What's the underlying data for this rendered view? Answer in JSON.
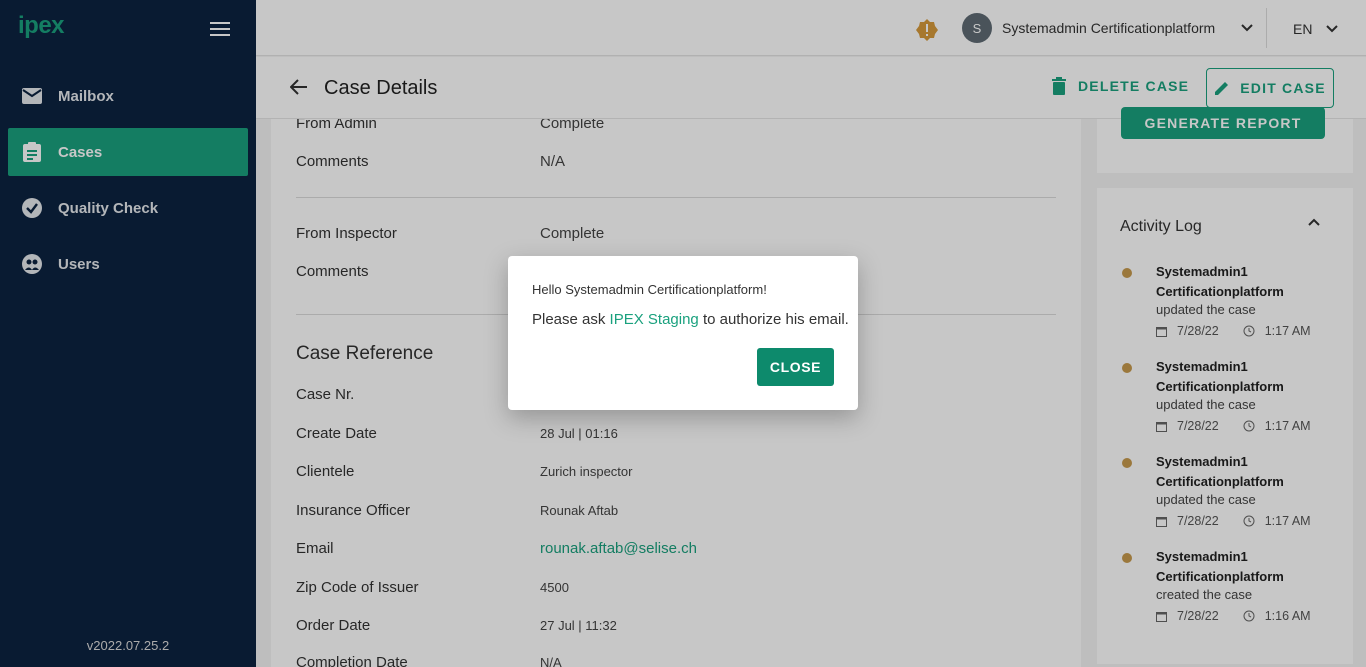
{
  "app": {
    "logo": "ipex",
    "version": "v2022.07.25.2"
  },
  "sidebar": {
    "items": [
      {
        "label": "Mailbox"
      },
      {
        "label": "Cases"
      },
      {
        "label": "Quality Check"
      },
      {
        "label": "Users"
      }
    ]
  },
  "topbar": {
    "avatar_initial": "S",
    "username": "Systemadmin Certificationplatform",
    "language": "EN"
  },
  "header": {
    "title": "Case Details",
    "delete_label": "DELETE CASE",
    "edit_label": "EDIT CASE"
  },
  "details": {
    "admin": {
      "label": "From Admin",
      "value": "Complete",
      "comments_label": "Comments",
      "comments_value": "N/A"
    },
    "inspector": {
      "label": "From Inspector",
      "value": "Complete",
      "comments_label": "Comments"
    },
    "case_reference": {
      "title": "Case Reference",
      "fields": [
        {
          "label": "Case Nr.",
          "value": ""
        },
        {
          "label": "Create Date",
          "value": "28 Jul | 01:16"
        },
        {
          "label": "Clientele",
          "value": "Zurich inspector"
        },
        {
          "label": "Insurance Officer",
          "value": "Rounak Aftab"
        },
        {
          "label": "Email",
          "value": "rounak.aftab@selise.ch"
        },
        {
          "label": "Zip Code of Issuer",
          "value": "4500"
        },
        {
          "label": "Order Date",
          "value": "27 Jul | 11:32"
        },
        {
          "label": "Completion Date",
          "value": "N/A"
        }
      ]
    }
  },
  "report": {
    "generate_label": "GENERATE REPORT"
  },
  "activity": {
    "title": "Activity Log",
    "items": [
      {
        "name": "Systemadmin1 Certificationplatform",
        "action": "updated the case",
        "date": "7/28/22",
        "time": "1:17 AM"
      },
      {
        "name": "Systemadmin1 Certificationplatform",
        "action": "updated the case",
        "date": "7/28/22",
        "time": "1:17 AM"
      },
      {
        "name": "Systemadmin1 Certificationplatform",
        "action": "updated the case",
        "date": "7/28/22",
        "time": "1:17 AM"
      },
      {
        "name": "Systemadmin1 Certificationplatform",
        "action": "created the case",
        "date": "7/28/22",
        "time": "1:16 AM"
      }
    ]
  },
  "modal": {
    "greeting": "Hello Systemadmin Certificationplatform!",
    "message_prefix": "Please ask ",
    "message_link": "IPEX Staging",
    "message_suffix": " to authorize his email.",
    "close_label": "CLOSE"
  },
  "colors": {
    "brand": "#1aa17e",
    "sidebar": "#0c2340",
    "dot": "#c79a4d"
  }
}
